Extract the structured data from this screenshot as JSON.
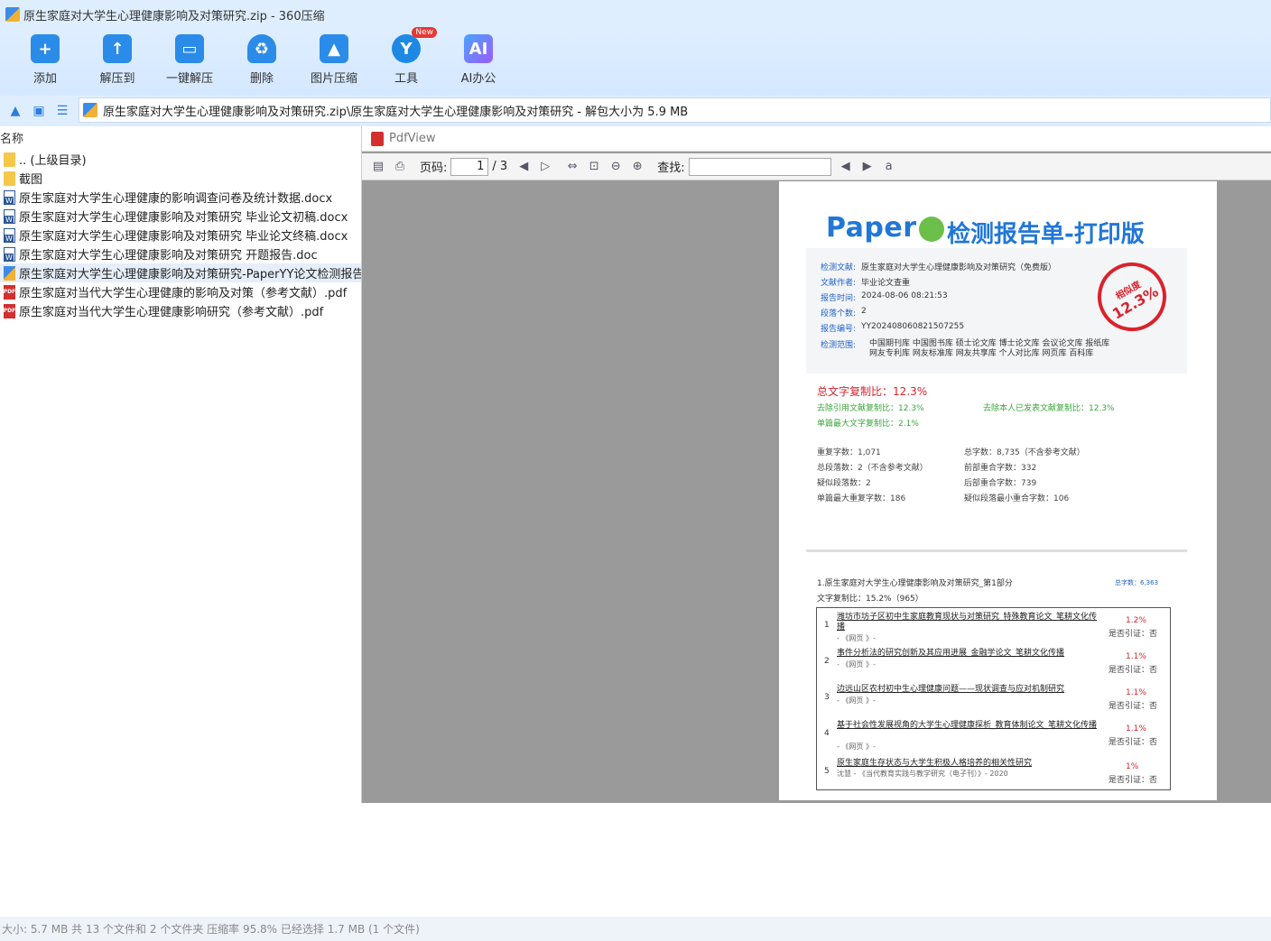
{
  "window": {
    "title": "原生家庭对大学生心理健康影响及对策研究.zip - 360压缩"
  },
  "toolbar": {
    "buttons": [
      {
        "label": "添加",
        "icon": "add-icon"
      },
      {
        "label": "解压到",
        "icon": "extract-icon"
      },
      {
        "label": "一键解压",
        "icon": "one-click-extract-icon"
      },
      {
        "label": "删除",
        "icon": "delete-icon"
      },
      {
        "label": "图片压缩",
        "icon": "image-compress-icon"
      },
      {
        "label": "工具",
        "icon": "tools-icon",
        "badge": "New"
      },
      {
        "label": "AI办公",
        "icon": "ai-office-icon",
        "glyph": "AI"
      }
    ]
  },
  "address": {
    "path": "原生家庭对大学生心理健康影响及对策研究.zip\\原生家庭对大学生心理健康影响及对策研究 - 解包大小为 5.9 MB"
  },
  "filelist": {
    "header": "名称",
    "rows": [
      {
        "name": ".. (上级目录)",
        "type": "folder"
      },
      {
        "name": "截图",
        "type": "folder"
      },
      {
        "name": "原生家庭对大学生心理健康的影响调查问卷及统计数据.docx",
        "type": "docx"
      },
      {
        "name": "原生家庭对大学生心理健康影响及对策研究 毕业论文初稿.docx",
        "type": "docx"
      },
      {
        "name": "原生家庭对大学生心理健康影响及对策研究 毕业论文终稿.docx",
        "type": "docx"
      },
      {
        "name": "原生家庭对大学生心理健康影响及对策研究 开题报告.doc",
        "type": "docx"
      },
      {
        "name": "原生家庭对大学生心理健康影响及对策研究-PaperYY论文检测报告.zip",
        "type": "zip",
        "selected": true
      },
      {
        "name": "原生家庭对当代大学生心理健康的影响及对策（参考文献）.pdf",
        "type": "pdf"
      },
      {
        "name": "原生家庭对当代大学生心理健康影响研究（参考文献）.pdf",
        "type": "pdf"
      }
    ]
  },
  "pdfview": {
    "title": "PdfView",
    "page_label": "页码:",
    "page_current": "1",
    "page_total": "/ 3",
    "find_label": "查找:"
  },
  "report": {
    "logo_text": "Paper",
    "title": "检测报告单-打印版",
    "info": [
      {
        "k": "检测文献:",
        "v": "原生家庭对大学生心理健康影响及对策研究（免费版）"
      },
      {
        "k": "文献作者:",
        "v": "毕业论文查重"
      },
      {
        "k": "报告时间:",
        "v": "2024-08-06 08:21:53"
      },
      {
        "k": "段落个数:",
        "v": "2"
      },
      {
        "k": "报告编号:",
        "v": "YY2024080608215072​55"
      }
    ],
    "scope_label": "检测范围:",
    "scope_line1": "中国期刊库  中国图书库  硕士论文库  博士论文库  会议论文库  报纸库",
    "scope_line2": "网友专利库  网友标准库  网友共享库  个人对比库  网页库  百科库",
    "stamp_top": "相似度",
    "stamp_value": "12.3%",
    "total_rate": "总文字复制比：12.3%",
    "excl_cite": "去除引用文献复制比：12.3%",
    "excl_self": "去除本人已发表文献复制比：12.3%",
    "single_max": "单篇最大文字复制比：2.1%",
    "stats": [
      "重复字数：1,071",
      "总字数：8,735（不含参考文献）",
      "总段落数：2（不含参考文献）",
      "前部重合字数：332",
      "疑似段落数：2",
      "后部重合字数：739",
      "单篇最大重复字数：186",
      "疑似段落最小重合字数：106"
    ],
    "section_title": "1.原生家庭对大学生心理健康影响及对策研究_第1部分",
    "section_count": "总字数：6,363",
    "section_rate": "文字复制比：15.2%（965）",
    "sources": [
      {
        "num": "1",
        "title": "潍坊市坊子区初中生家庭教育现状与对策研究_特殊教育论文_笔耕文化传播",
        "sub": "- 《网页 》-",
        "pct": "1.2%",
        "cite": "是否引证：否"
      },
      {
        "num": "2",
        "title": "事件分析法的研究创新及其应用进展_金融学论文_笔耕文化传播",
        "sub": "- 《网页 》-",
        "pct": "1.1%",
        "cite": "是否引证：否"
      },
      {
        "num": "3",
        "title": "边远山区农村初中生心理健康问题——现状调查与应对机制研究",
        "sub": "- 《网页 》-",
        "pct": "1.1%",
        "cite": "是否引证：否"
      },
      {
        "num": "4",
        "title": "基于社会性发展视角的大学生心理健康探析_教育体制论文_笔耕文化传播",
        "sub": "- 《网页 》-",
        "pct": "1.1%",
        "cite": "是否引证：否"
      },
      {
        "num": "5",
        "title": "原生家庭生存状态与大学生积极人格培养的相关性研究",
        "sub": "沈慧 - 《当代教育实践与教学研究（电子刊）》- 2020",
        "pct": "1%",
        "cite": "是否引证：否"
      }
    ]
  },
  "status": {
    "text": "大小: 5.7 MB 共 13 个文件和 2 个文件夹 压缩率 95.8% 已经选择 1.7 MB (1 个文件)"
  }
}
